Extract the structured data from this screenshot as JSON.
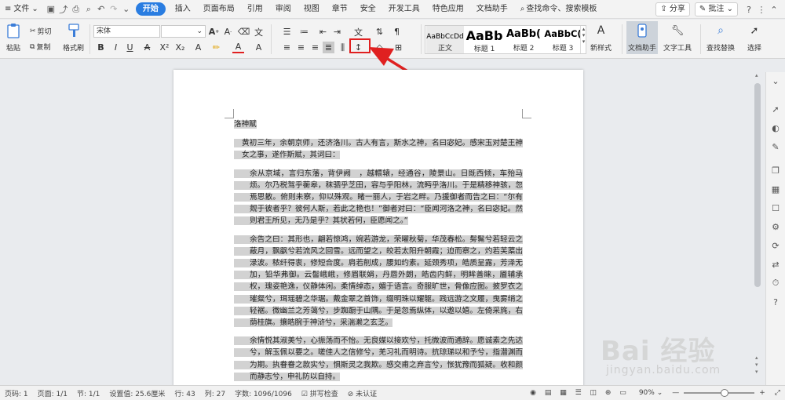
{
  "menubar": {
    "file": "文件",
    "tabs": [
      "开始",
      "插入",
      "页面布局",
      "引用",
      "审阅",
      "视图",
      "章节",
      "安全",
      "开发工具",
      "特色应用",
      "文档助手"
    ],
    "search": "查找命令、搜索模板",
    "share": "分享",
    "annotate": "批注"
  },
  "ribbon": {
    "paste": "粘贴",
    "cut": "剪切",
    "copy": "复制",
    "format_painter": "格式刷",
    "font_name": "宋体",
    "font_size": "",
    "bold": "B",
    "italic": "I",
    "underline": "U",
    "strike": "A",
    "font_color": "A",
    "grow_font": "A",
    "shrink_font": "A",
    "styles": [
      {
        "preview": "AaBbCcDd",
        "label": "正文"
      },
      {
        "preview": "AaBb",
        "label": "标题 1"
      },
      {
        "preview": "AaBb(",
        "label": "标题 2"
      },
      {
        "preview": "AaBbC(",
        "label": "标题 3"
      }
    ],
    "new_style": "新样式",
    "doc_assistant": "文档助手",
    "text_tools": "文字工具",
    "find_replace": "查找替换",
    "select": "选择"
  },
  "document": {
    "title": "洛神赋",
    "paragraphs": [
      "黄初三年，余朝京师，还济洛川。古人有言，斯水之神，名曰宓妃。感宋玉对楚王神女之事，遂作斯赋，其词曰：",
      "余从京域，言归东藩，背伊阙　，越轘辕，经通谷，陵景山。日既西倾，车殆马烦。尔乃税驾乎蘅皋，秣驷乎芝田，容与乎阳林，流眄乎洛川。于是精移神骇，忽焉思散。俯则未察，仰以殊观。睹一丽人，于岩之畔。乃援御者而告之曰：“尔有觌于彼者乎？彼何人斯，若此之艳也！”御者对曰：“臣闻河洛之神，名曰宓妃。然则君王所见，无乃是乎？其状若何，臣愿闻之。”",
      "余告之曰：其形也，翩若惊鸿，婉若游龙，荣曜秋菊，华茂春松。髣髴兮若轻云之蔽月，飘飖兮若流风之回雪。远而望之，皎若太阳升朝霞；迫而察之，灼若芙蕖出渌波。秾纤得衷，修短合度。肩若削成，腰如约素。延颈秀项，皓质呈露，芳泽无加，铅华弗御。云髻峨峨，修眉联娟，丹唇外朗，皓齿内鲜，明眸善睐，靥辅承权，瑰姿艳逸，仪静体闲。柔情绰态，媚于语言。奇服旷世，骨像应图。披罗衣之璀粲兮，珥瑶碧之华琚。戴金翠之首饰，缀明珠以耀躯。践远游之文履，曳雾绡之轻裾。微幽兰之芳蔼兮，步踟蹰于山隅。于是忽焉纵体，以遨以嬉。左倚采旄，右荫桂旗。攘皓腕于神浒兮，采湍濑之玄芝。",
      "余情悦其淑美兮，心振荡而不怡。无良媒以接欢兮，托微波而通辞。愿诚素之先达兮，解玉佩以要之。嗟佳人之信修兮，羌习礼而明诗。抗琼珶以和予兮，指潜渊而为期。执眷眷之款实兮，惧斯灵之我欺。感交甫之弃言兮，怅犹豫而狐疑。收和颜而静志兮，申礼防以自持。"
    ]
  },
  "statusbar": {
    "page": "页码: 1",
    "pages": "页面: 1/1",
    "section": "节: 1/1",
    "setting": "设置值: 25.6厘米",
    "row": "行: 43",
    "col": "列: 27",
    "words": "字数: 1096/1096",
    "spell": "拼写检查",
    "cert": "未认证",
    "zoom": "90%"
  },
  "watermark": {
    "brand": "Bai 经验",
    "url": "jingyan.baidu.com"
  },
  "colors": {
    "accent": "#2a7de1",
    "highlight": "#e02020",
    "selection": "#d2d2d2"
  }
}
